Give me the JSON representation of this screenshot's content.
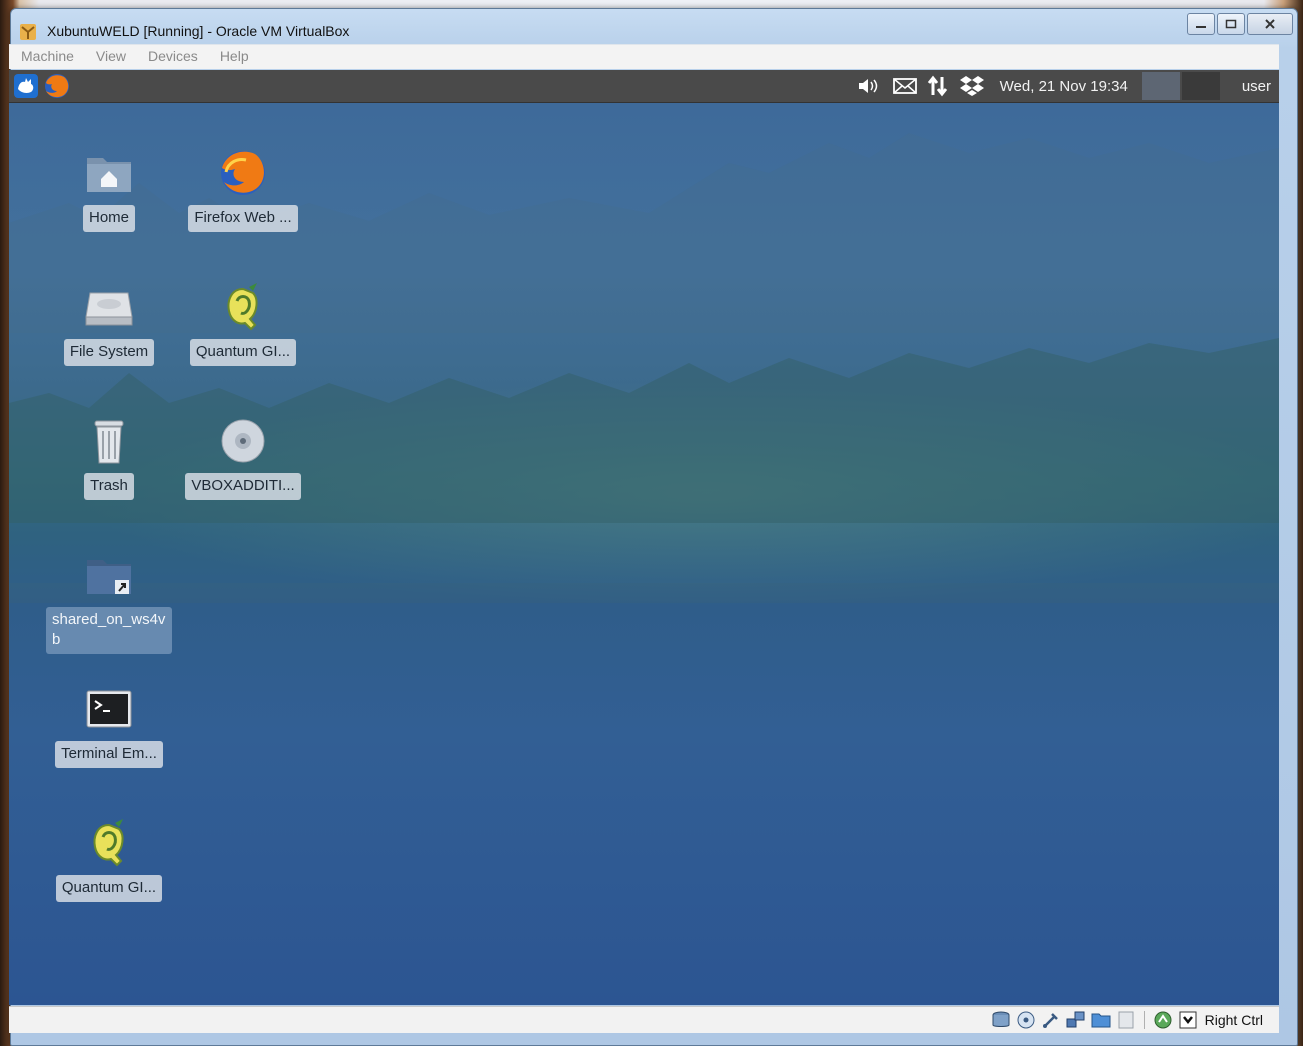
{
  "window": {
    "title": "XubuntuWELD [Running] - Oracle VM VirtualBox",
    "controls": {
      "minimize": "minimize",
      "maximize": "maximize",
      "close": "close"
    }
  },
  "menubar": {
    "items": [
      "Machine",
      "View",
      "Devices",
      "Help"
    ]
  },
  "panel": {
    "launchers": [
      "xfce-menu-icon",
      "firefox-icon"
    ],
    "tray_icons": [
      "volume-icon",
      "mail-icon",
      "network-icon",
      "dropbox-icon"
    ],
    "clock": "Wed, 21 Nov  19:34",
    "user": "user"
  },
  "desktop": {
    "icons": [
      {
        "label": "Home",
        "icon": "home-folder-icon"
      },
      {
        "label": "Firefox Web ...",
        "icon": "firefox-icon"
      },
      {
        "label": "File System",
        "icon": "hard-drive-icon"
      },
      {
        "label": "Quantum GI...",
        "icon": "qgis-icon"
      },
      {
        "label": "Trash",
        "icon": "trash-icon"
      },
      {
        "label": "VBOXADDITI...",
        "icon": "cdrom-icon"
      },
      {
        "label": "shared_on_ws4vb",
        "icon": "folder-link-icon"
      },
      {
        "label": "Terminal Em...",
        "icon": "terminal-icon"
      },
      {
        "label": "Quantum GI...",
        "icon": "qgis-icon"
      }
    ]
  },
  "statusbar": {
    "icons": [
      "hard-disk-icon",
      "optical-drive-icon",
      "usb-icon",
      "network-adapters-icon",
      "shared-folders-icon",
      "display-icon",
      "capture-icon",
      "mouse-integration-icon"
    ],
    "host_key": "Right Ctrl"
  },
  "colors": {
    "panel": "#4a4a4a",
    "desktop_top": "#3e6a9a",
    "desktop_bottom": "#2c5592"
  }
}
